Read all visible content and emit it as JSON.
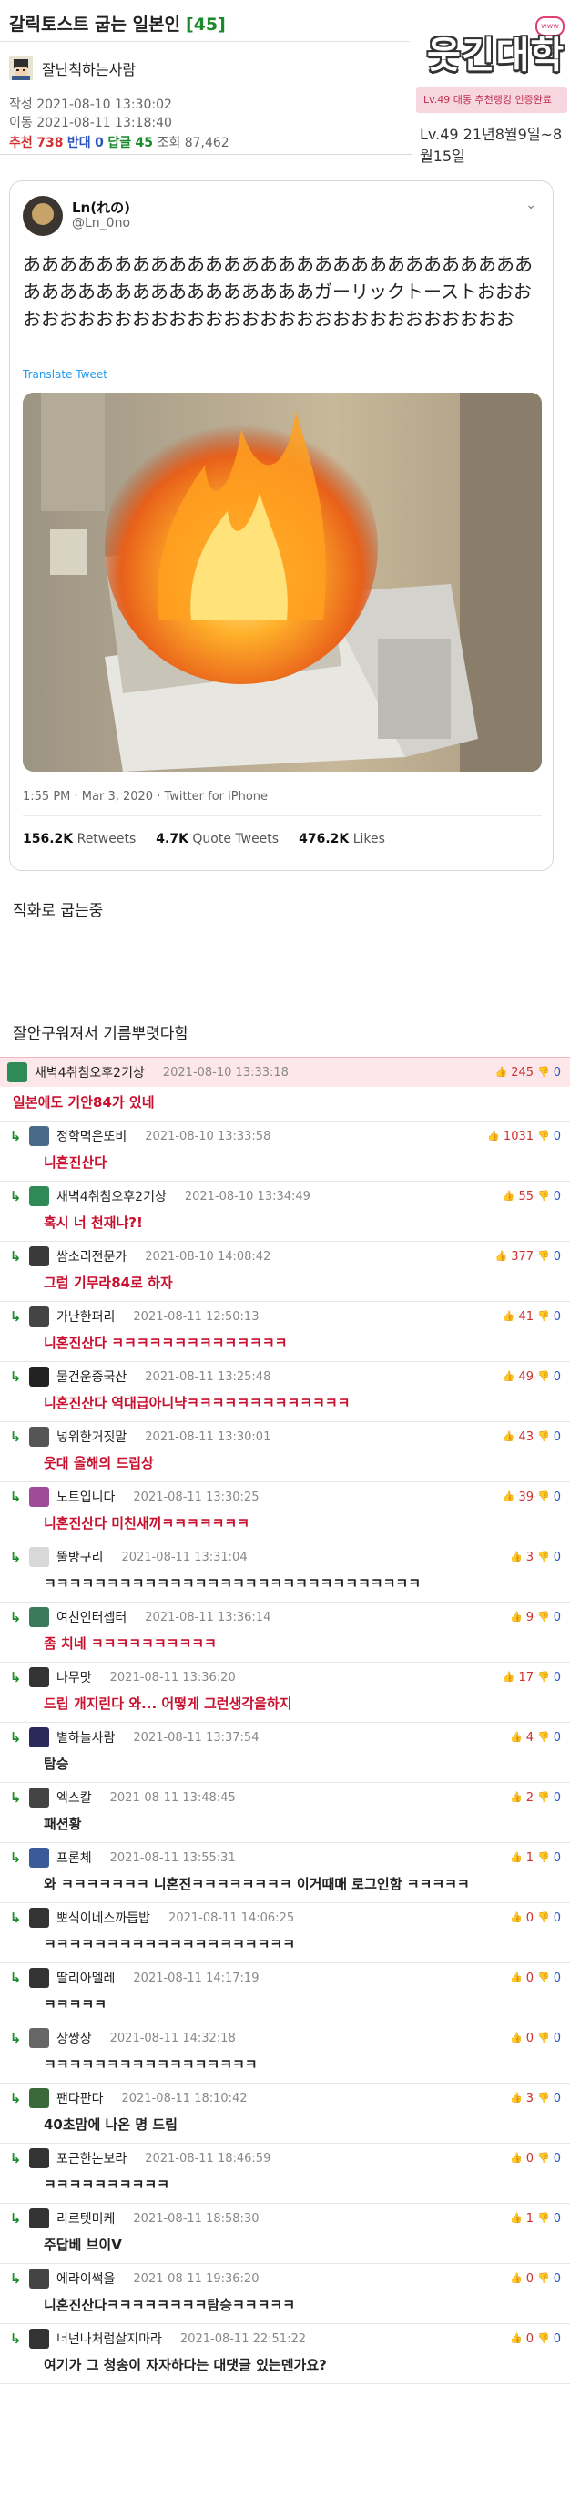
{
  "post": {
    "title": "갈릭토스트 굽는 일본인",
    "comment_count": "[45]",
    "author": "잘난척하는사람",
    "meta_written_label": "작성",
    "written": "2021-08-10 13:30:02",
    "meta_moved_label": "이동",
    "moved": "2021-08-11 13:18:40",
    "recommend_label": "추천",
    "recommend": "738",
    "oppose_label": "반대",
    "oppose": "0",
    "reply_label": "답글",
    "reply": "45",
    "views_label": "조회",
    "views": "87,462"
  },
  "logo": {
    "text": "웃긴대학",
    "badge": "www.humoruniv",
    "bar_text": "Lv.49 대동 추천랭킹 인증완료",
    "date_text": "Lv.49 21년8월9일~8월15일"
  },
  "tweet": {
    "name": "Ln(れの)",
    "handle": "@Ln_0no",
    "text": "ああああああああああああああああああああああああああああああああああああああああああああガーリックトーストおおおおおおおおおおおおおおおおおおおおおおおおおおおおおお",
    "translate": "Translate Tweet",
    "time": "1:55 PM · Mar 3, 2020 · Twitter for iPhone",
    "retweets": "156.2K",
    "retweets_label": "Retweets",
    "quotes": "4.7K",
    "quotes_label": "Quote Tweets",
    "likes": "476.2K",
    "likes_label": "Likes"
  },
  "body": {
    "line1": "직화로 굽는중",
    "line2": "잘안구워져서 기름뿌렷다함"
  },
  "comments": [
    {
      "nick": "새벽4취침오후2기상",
      "time": "2021-08-10 13:33:18",
      "up": "245",
      "down": "0",
      "text": "일본에도 기안84가 있네",
      "best": true,
      "color": "#2e8b57"
    },
    {
      "nick": "정학먹은또비",
      "time": "2021-08-10 13:33:58",
      "up": "1031",
      "down": "0",
      "text": "니혼진산다",
      "color": "#4a6a8a"
    },
    {
      "nick": "새벽4취침오후2기상",
      "time": "2021-08-10 13:34:49",
      "up": "55",
      "down": "0",
      "text": "혹시 너 천재냐?!",
      "color": "#2e8b57"
    },
    {
      "nick": "쌈소리전문가",
      "time": "2021-08-10 14:08:42",
      "up": "377",
      "down": "0",
      "text": "그럼 기무라84로 하자",
      "color": "#3a3a3a"
    },
    {
      "nick": "가난한퍼리",
      "time": "2021-08-11 12:50:13",
      "up": "41",
      "down": "0",
      "text": "니혼진산다 ㅋㅋㅋㅋㅋㅋㅋㅋㅋㅋㅋㅋㅋㅋ",
      "color": "#444"
    },
    {
      "nick": "물건운중국산",
      "time": "2021-08-11 13:25:48",
      "up": "49",
      "down": "0",
      "text": "니혼진산다 역대급아니냑ㅋㅋㅋㅋㅋㅋㅋㅋㅋㅋㅋㅋㅋ",
      "color": "#222"
    },
    {
      "nick": "넣위한거짓말",
      "time": "2021-08-11 13:30:01",
      "up": "43",
      "down": "0",
      "text": "웃대 올해의 드립상",
      "color": "#555"
    },
    {
      "nick": "노트입니다",
      "time": "2021-08-11 13:30:25",
      "up": "39",
      "down": "0",
      "text": "니혼진산다 미친새끼ㅋㅋㅋㅋㅋㅋㅋ",
      "color": "#a04a9a"
    },
    {
      "nick": "뚤방구리",
      "time": "2021-08-11 13:31:04",
      "up": "3",
      "down": "0",
      "text": "ㅋㅋㅋㅋㅋㅋㅋㅋㅋㅋㅋㅋㅋㅋㅋㅋㅋㅋㅋㅋㅋㅋㅋㅋㅋㅋㅋㅋㅋㅋ",
      "color": "#d8d8d8",
      "black": true
    },
    {
      "nick": "여친인터셉터",
      "time": "2021-08-11 13:36:14",
      "up": "9",
      "down": "0",
      "text": "좀 치네 ㅋㅋㅋㅋㅋㅋㅋㅋㅋㅋ",
      "color": "#3a7a5a"
    },
    {
      "nick": "나무맛",
      "time": "2021-08-11 13:36:20",
      "up": "17",
      "down": "0",
      "text": "드립 개지린다 와... 어떻게 그런생각을하지",
      "color": "#333"
    },
    {
      "nick": "별하늘사람",
      "time": "2021-08-11 13:37:54",
      "up": "4",
      "down": "0",
      "text": "탐승",
      "color": "#2a2a5a",
      "black": true
    },
    {
      "nick": "엑스칼",
      "time": "2021-08-11 13:48:45",
      "up": "2",
      "down": "0",
      "text": "패션황",
      "color": "#444",
      "black": true
    },
    {
      "nick": "프론체",
      "time": "2021-08-11 13:55:31",
      "up": "1",
      "down": "0",
      "text": "와 ㅋㅋㅋㅋㅋㅋㅋ 니혼진ㅋㅋㅋㅋㅋㅋㅋㅋ 이거때매 로그인함 ㅋㅋㅋㅋㅋ",
      "color": "#3a5a9a",
      "black": true
    },
    {
      "nick": "뽀식이네스까듭밥",
      "time": "2021-08-11 14:06:25",
      "up": "0",
      "down": "0",
      "text": "ㅋㅋㅋㅋㅋㅋㅋㅋㅋㅋㅋㅋㅋㅋㅋㅋㅋㅋㅋㅋ",
      "color": "#333",
      "black": true
    },
    {
      "nick": "딸리아멜레",
      "time": "2021-08-11 14:17:19",
      "up": "0",
      "down": "0",
      "text": "ㅋㅋㅋㅋㅋ",
      "color": "#333",
      "black": true
    },
    {
      "nick": "상쌍상",
      "time": "2021-08-11 14:32:18",
      "up": "0",
      "down": "0",
      "text": "ㅋㅋㅋㅋㅋㅋㅋㅋㅋㅋㅋㅋㅋㅋㅋㅋㅋ",
      "color": "#666",
      "black": true
    },
    {
      "nick": "팬다판다",
      "time": "2021-08-11 18:10:42",
      "up": "3",
      "down": "0",
      "text": "40초맘에 나온 명 드립",
      "color": "#3a6a3a",
      "black": true
    },
    {
      "nick": "포근한논보라",
      "time": "2021-08-11 18:46:59",
      "up": "0",
      "down": "0",
      "text": "ㅋㅋㅋㅋㅋㅋㅋㅋㅋㅋ",
      "color": "#333",
      "black": true
    },
    {
      "nick": "리르텟미케",
      "time": "2021-08-11 18:58:30",
      "up": "1",
      "down": "0",
      "text": "주답베 브이V",
      "color": "#333",
      "black": true
    },
    {
      "nick": "에라이썩을",
      "time": "2021-08-11 19:36:20",
      "up": "0",
      "down": "0",
      "text": "니혼진산다ㅋㅋㅋㅋㅋㅋㅋㅋ탐승ㅋㅋㅋㅋㅋ",
      "color": "#444",
      "black": true
    },
    {
      "nick": "너넌나처럼살지마라",
      "time": "2021-08-11 22:51:22",
      "up": "0",
      "down": "0",
      "text": "여기가 그 청송이 자자하다는 대댓글 있는덴가요?",
      "color": "#333",
      "black": true
    }
  ]
}
